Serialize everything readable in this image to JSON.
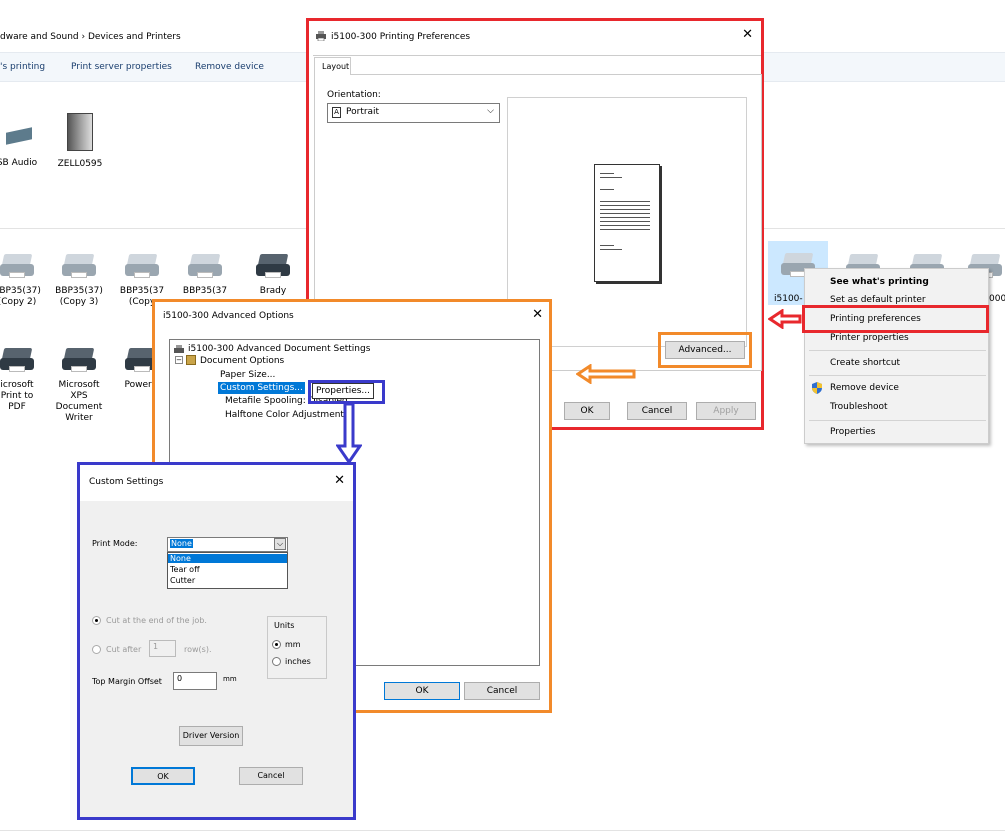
{
  "explorer": {
    "breadcrumb": "dware and Sound  ›  Devices and Printers",
    "toolbar": [
      "'s printing",
      "Print server properties",
      "Remove device"
    ],
    "devices_row1": [
      {
        "label": "SB Audio",
        "icon": "speaker-icon"
      },
      {
        "label": "ZELL0595",
        "icon": "computer-tower-icon"
      }
    ],
    "printers_row1": [
      {
        "label": "BBP35(37)\n(Copy 2)"
      },
      {
        "label": "BBP35(37)\n(Copy 3)"
      },
      {
        "label": "BBP35(37\n(Copy"
      },
      {
        "label": "BBP35(37"
      },
      {
        "label": "Brady"
      }
    ],
    "printers_row2": [
      {
        "label": "icrosoft\nPrint to\nPDF"
      },
      {
        "label": "Microsoft\nXPS\nDocument\nWriter"
      },
      {
        "label": "PowerM"
      }
    ],
    "right_printers": [
      "i5100-",
      "000"
    ]
  },
  "printing_prefs": {
    "title": "i5100-300 Printing Preferences",
    "close": "✕",
    "tab": "Layout",
    "orientation_label": "Orientation:",
    "orientation_value": "Portrait",
    "advanced_btn": "Advanced...",
    "ok": "OK",
    "cancel": "Cancel",
    "apply": "Apply"
  },
  "advanced_options": {
    "title": "i5100-300 Advanced Options",
    "close": "✕",
    "root": "i5100-300 Advanced Document Settings",
    "document_options": "Document Options",
    "paper_size": "Paper Size...",
    "custom_settings": "Custom Settings...",
    "properties_btn": "Properties...",
    "metafile": "Metafile Spooling: Disabled",
    "halftone": "Halftone Color Adjustment...",
    "ok": "OK",
    "cancel": "Cancel"
  },
  "context_menu": {
    "items": [
      "See what's printing",
      "Set as default printer",
      "Printing preferences",
      "Printer properties",
      "Create shortcut",
      "Remove device",
      "Troubleshoot",
      "Properties"
    ]
  },
  "custom_settings": {
    "title": "Custom Settings",
    "close": "✕",
    "print_mode_label": "Print Mode:",
    "print_mode_value": "None",
    "options": [
      "None",
      "Tear off",
      "Cutter"
    ],
    "cut_end": "Cut at the end of the job.",
    "cut_after": "Cut after",
    "cut_after_value": "1",
    "rows_label": "row(s).",
    "units_label": "Units",
    "unit_mm": "mm",
    "unit_inches": "inches",
    "top_margin_label": "Top Margin Offset",
    "top_margin_value": "0",
    "top_margin_unit": "mm",
    "driver_version": "Driver Version",
    "ok": "OK",
    "cancel": "Cancel"
  },
  "colors": {
    "red": "#e8282d",
    "orange": "#f28a2a",
    "blue": "#3a3acb",
    "select": "#0078d7"
  }
}
